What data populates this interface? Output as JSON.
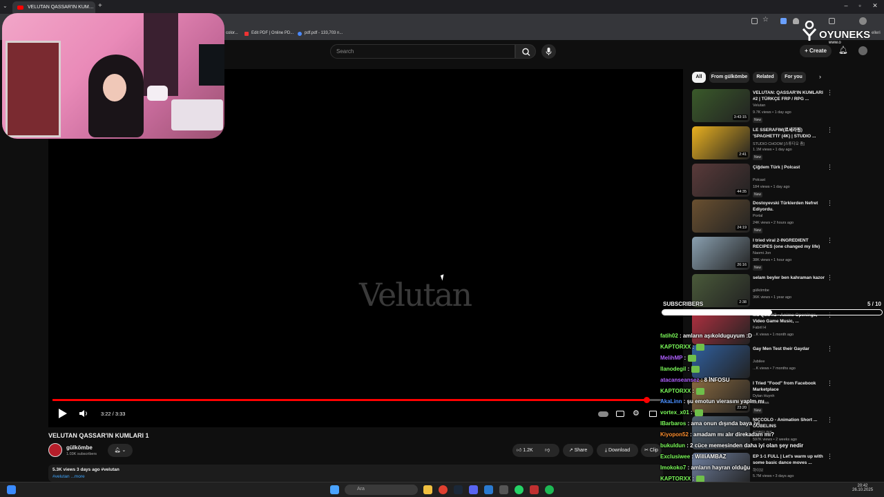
{
  "browser": {
    "tab_title": "VELUTAN QASSAR'IN KUM…",
    "new_tab": "+",
    "bookmarks": [
      "color...",
      "Edit PDF | Online PD...",
      "pdf.pdf - 133,703 n..."
    ]
  },
  "watermark": {
    "brand": "OYUNEKS",
    "sub": "www.o",
    "extra": "elleri"
  },
  "header": {
    "search_placeholder": "Search",
    "create_label": "Create"
  },
  "player": {
    "overlay_logo": "Velutan",
    "time": "3:22 / 3:33",
    "progress": 0.985
  },
  "video": {
    "title": "VELUTAN QASSAR'IN KUMLARI 1",
    "channel": "gülkömbe",
    "subscribers": "1.03K subscribers",
    "likes": "1.2K",
    "share": "Share",
    "download": "Download",
    "clip": "Clip",
    "views_line": "5.3K views  3 days ago  #velutan",
    "desc_line": "#velutan ...more"
  },
  "chips": [
    "All",
    "From gülkömbe",
    "Related",
    "For you"
  ],
  "sidebar": [
    {
      "title": "VELUTAN: QASSAR'IN KUMLARI #2 | TÜRKÇE FRP / RPG ...",
      "channel": "Velutan",
      "meta": "9.7K views • 1 day ago",
      "new": "New",
      "dur": "3:43:15",
      "color": "#3a5a2a"
    },
    {
      "title": "LE SSERAFIM(르세라핌) 'SPAGHETTI' (4K) | STUDIO ...",
      "channel": "STUDIO CHOOM [스튜디오 춤]",
      "meta": "1.1M views • 1 day ago",
      "new": "New",
      "dur": "2:41",
      "color": "#e8b020"
    },
    {
      "title": "Çiğdem Türk | Polcast",
      "channel": "Polcast",
      "meta": "184 views • 1 day ago",
      "new": "New",
      "dur": "44:35",
      "color": "#5a3a3a"
    },
    {
      "title": "Dostoyevski Türklerden Nefret Ediyordu.",
      "channel": "Portal",
      "meta": "24K views • 2 hours ago",
      "new": "New",
      "dur": "24:19",
      "color": "#6a5030"
    },
    {
      "title": "I tried viral 2-INGREDIENT RECIPES (one changed my life)",
      "channel": "Naomi Jon",
      "meta": "38K views • 1 hour ago",
      "new": "New",
      "dur": "26:16",
      "color": "#8aa0b0"
    },
    {
      "title": "selam beyler ben kahraman kazor",
      "channel": "gülkömbe",
      "meta": "36K views • 1 year ago",
      "new": "",
      "dur": "2:38",
      "color": "#4a5a3a"
    },
    {
      "title": "...d Quiz #3 - Anime Openings, Video Game Music, ...",
      "channel": "Fabril H",
      "meta": "...K views • 1 month ago",
      "new": "",
      "dur": "",
      "color": "#b03040"
    },
    {
      "title": "Gay Men Test their Gaydar",
      "channel": "Jubilee",
      "meta": "...K views • 7 months ago",
      "new": "",
      "dur": "",
      "color": "#3060a0"
    },
    {
      "title": "I Tried \"Food\" from Facebook Marketplace",
      "channel": "Dylan Huynh",
      "meta": "...K views",
      "new": "New",
      "dur": "23:20",
      "color": "#8a6a40"
    },
    {
      "title": "NICCOLO - Animation Short ... GOBELINS",
      "channel": "GOBELINS",
      "meta": "597K views • 2 weeks ago",
      "new": "",
      "dur": "",
      "color": "#506070"
    },
    {
      "title": "EP 1-1 FULL | Let's warm up with some basic dance moves ...",
      "channel": "하이브",
      "meta": "5.7M views • 3 days ago",
      "new": "",
      "dur": "",
      "color": "#7080a0"
    }
  ],
  "subscribers": {
    "label": "SUBSCRIBERS",
    "count": "5 / 10",
    "fraction": 0.5
  },
  "chat": [
    {
      "user": "fatih02",
      "msg": "amların aşıkolduguyum :D",
      "color": "#7cfc5a"
    },
    {
      "user": "KAPTORXX",
      "msg": "",
      "color": "#7cfc5a",
      "emote": true
    },
    {
      "user": "MelihMP",
      "msg": "",
      "color": "#b060ff",
      "emote": true
    },
    {
      "user": "llanodegil",
      "msg": "",
      "color": "#7cfc5a",
      "emote": true
    },
    {
      "user": "atacanseansez",
      "msg": "8 İNFOSU",
      "color": "#b060ff"
    },
    {
      "user": "KAPTORXX",
      "msg": "",
      "color": "#7cfc5a",
      "emote": true
    },
    {
      "user": "AkaLinn",
      "msg": "şu emotun vierasını yaplm mı",
      "color": "#4a90ff"
    },
    {
      "user": "vortex_x01",
      "msg": "",
      "color": "#7cfc5a",
      "emote": true
    },
    {
      "user": "IBarbaros",
      "msg": "ama onun dışında baya iyi",
      "color": "#7cfc5a"
    },
    {
      "user": "Kiyopon52",
      "msg": "amadam mı alır direkadam mı?",
      "color": "#ff9030"
    },
    {
      "user": "bukuldun",
      "msg": "2 cüce memesinden daha iyi olan şey nedir",
      "color": "#7cfc5a"
    },
    {
      "user": "Exclusiwee",
      "msg": "WilliAMBAZ",
      "color": "#7cfc5a"
    },
    {
      "user": "Imokoko7",
      "msg": "amların hayran olduğu",
      "color": "#7cfc5a"
    },
    {
      "user": "KAPTORXX",
      "msg": "",
      "color": "#7cfc5a",
      "emote": true
    },
    {
      "user": "pompaberat",
      "msg": "worth bu arada",
      "color": "#b060ff"
    }
  ],
  "taskbar": {
    "search_placeholder": "Ara",
    "time": "20:42",
    "date": "26.10.2025"
  },
  "colors": {
    "accent": "#ff0000",
    "bg": "#0f0f0f"
  }
}
